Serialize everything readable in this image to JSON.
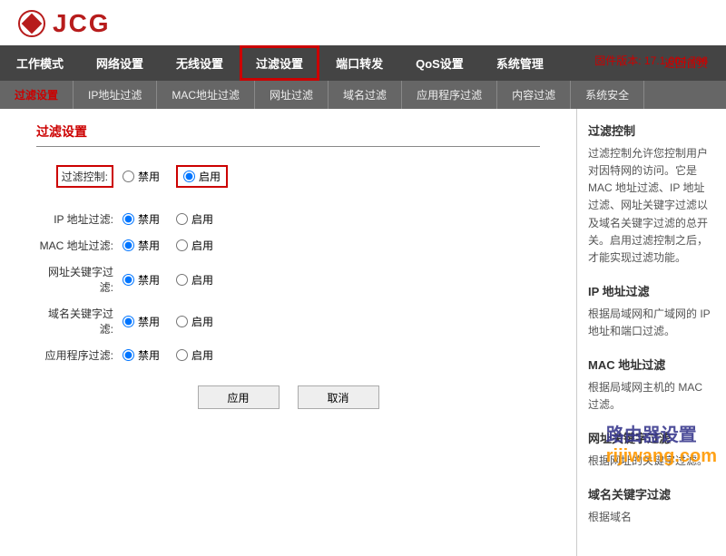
{
  "logo": {
    "text": "JCG"
  },
  "header": {
    "firmware_label": "固件版本:",
    "firmware_version": "17.1.004.786",
    "back_link": "返回首页"
  },
  "main_nav": [
    "工作模式",
    "网络设置",
    "无线设置",
    "过滤设置",
    "端口转发",
    "QoS设置",
    "系统管理"
  ],
  "main_nav_active": 3,
  "sub_nav": [
    "过滤设置",
    "IP地址过滤",
    "MAC地址过滤",
    "网址过滤",
    "域名过滤",
    "应用程序过滤",
    "内容过滤",
    "系统安全"
  ],
  "sub_nav_active": 0,
  "panel": {
    "title": "过滤设置",
    "filter_control": {
      "label": "过滤控制:",
      "disable": "禁用",
      "enable": "启用",
      "value": "enable"
    },
    "rows": [
      {
        "label": "IP 地址过滤:",
        "disable": "禁用",
        "enable": "启用",
        "value": "disable"
      },
      {
        "label": "MAC 地址过滤:",
        "disable": "禁用",
        "enable": "启用",
        "value": "disable"
      },
      {
        "label": "网址关键字过滤:",
        "disable": "禁用",
        "enable": "启用",
        "value": "disable"
      },
      {
        "label": "域名关键字过滤:",
        "disable": "禁用",
        "enable": "启用",
        "value": "disable"
      },
      {
        "label": "应用程序过滤:",
        "disable": "禁用",
        "enable": "启用",
        "value": "disable"
      }
    ],
    "apply": "应用",
    "cancel": "取消"
  },
  "sidebar": [
    {
      "title": "过滤控制",
      "body": "过滤控制允许您控制用户对因特网的访问。它是MAC 地址过滤、IP 地址过滤、网址关键字过滤以及域名关键字过滤的总开关。启用过滤控制之后，才能实现过滤功能。"
    },
    {
      "title": "IP 地址过滤",
      "body": "根据局域网和广域网的 IP 地址和端口过滤。"
    },
    {
      "title": "MAC 地址过滤",
      "body": "根据局域网主机的 MAC 过滤。"
    },
    {
      "title": "网址关键字过滤",
      "body": "根据网址的关键字过滤。"
    },
    {
      "title": "域名关键字过滤",
      "body": "根据域名"
    }
  ],
  "watermark": {
    "cn": "路由器设置",
    "en": "rijiwang.com"
  }
}
